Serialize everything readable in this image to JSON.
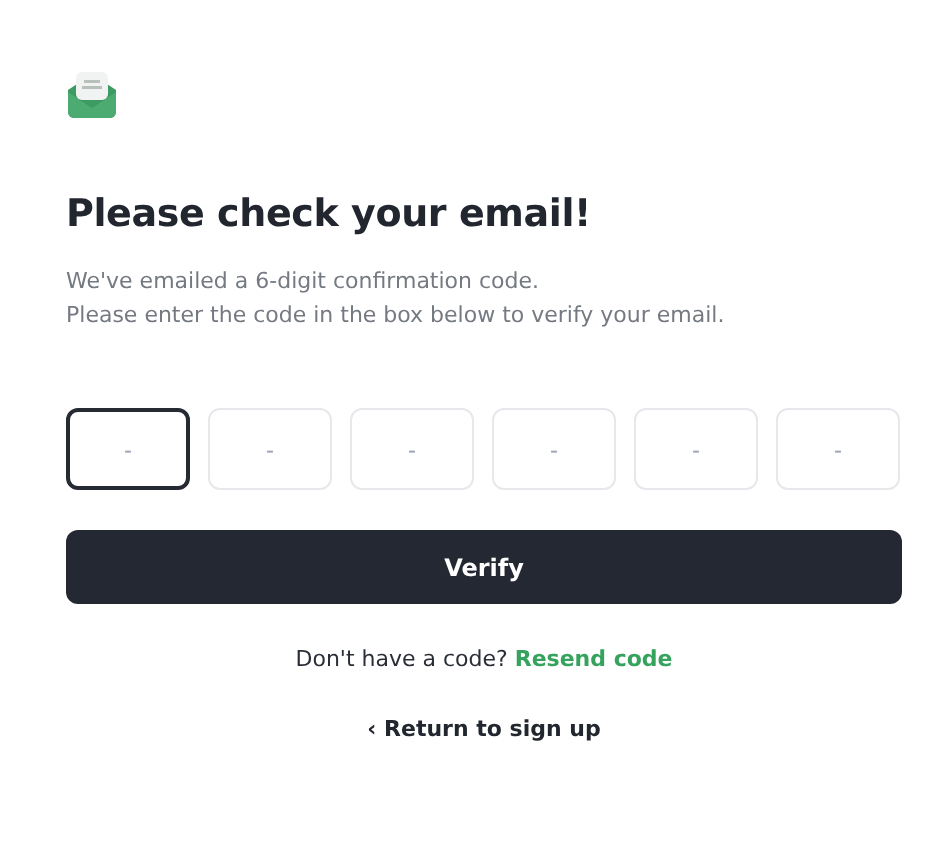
{
  "title": "Please check your email!",
  "description": [
    "We've emailed a 6-digit confirmation code.",
    "Please enter the code in the box below to verify your email."
  ],
  "code_fields": [
    {
      "placeholder": "-",
      "focused": true
    },
    {
      "placeholder": "-",
      "focused": false
    },
    {
      "placeholder": "-",
      "focused": false
    },
    {
      "placeholder": "-",
      "focused": false
    },
    {
      "placeholder": "-",
      "focused": false
    },
    {
      "placeholder": "-",
      "focused": false
    }
  ],
  "verify_button": "Verify",
  "resend": {
    "prompt": "Don't have a code?",
    "link": "Resend code"
  },
  "back_link": {
    "icon": "‹",
    "label": "Return to sign up"
  }
}
